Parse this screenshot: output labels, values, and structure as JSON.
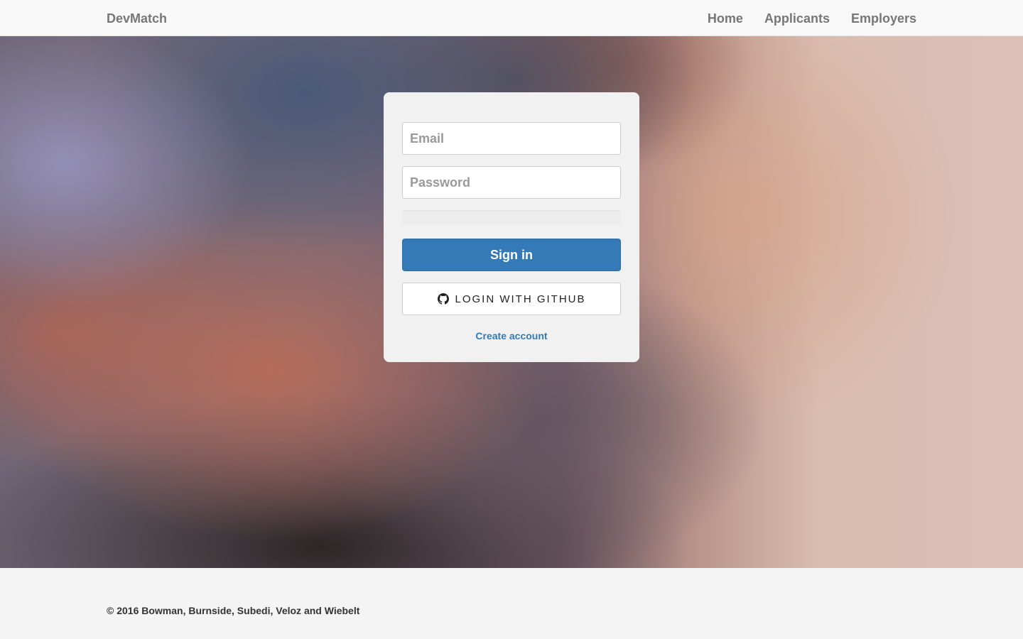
{
  "navbar": {
    "brand": "DevMatch",
    "links": [
      {
        "label": "Home"
      },
      {
        "label": "Applicants"
      },
      {
        "label": "Employers"
      }
    ]
  },
  "login": {
    "email_placeholder": "Email",
    "email_value": "",
    "password_placeholder": "Password",
    "password_value": "",
    "signin_label": "Sign in",
    "github_label": "LOGIN WITH GITHUB",
    "github_icon": "github-icon",
    "create_account_label": "Create account"
  },
  "footer": {
    "copyright": "© 2016 Bowman, Burnside, Subedi, Veloz and Wiebelt"
  },
  "colors": {
    "primary": "#337ab7",
    "nav_text": "#777777",
    "card_bg": "#f1f1f1"
  }
}
